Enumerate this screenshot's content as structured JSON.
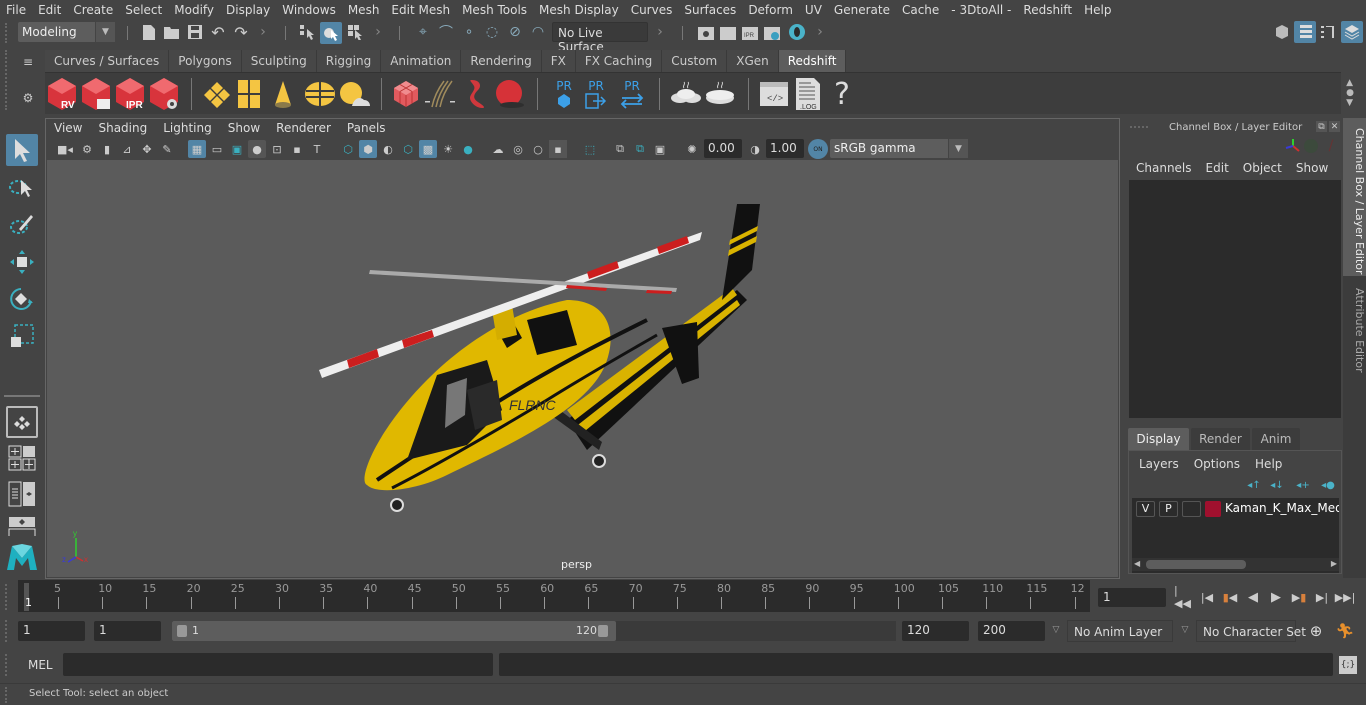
{
  "menubar": [
    "File",
    "Edit",
    "Create",
    "Select",
    "Modify",
    "Display",
    "Windows",
    "Mesh",
    "Edit Mesh",
    "Mesh Tools",
    "Mesh Display",
    "Curves",
    "Surfaces",
    "Deform",
    "UV",
    "Generate",
    "Cache",
    "- 3DtoAll -",
    "Redshift",
    "Help"
  ],
  "status_line": {
    "mode_dropdown": "Modeling",
    "live_surface": "No Live Surface"
  },
  "shelf": {
    "tabs": [
      "Curves / Surfaces",
      "Polygons",
      "Sculpting",
      "Rigging",
      "Animation",
      "Rendering",
      "FX",
      "FX Caching",
      "Custom",
      "XGen",
      "Redshift"
    ],
    "active_tab": "Redshift",
    "icons": [
      "redshift-rv-icon",
      "redshift-render-sequence-icon",
      "redshift-ipr-icon",
      "redshift-settings-icon",
      "rs-plane-light-icon",
      "rs-portal-light-icon",
      "rs-spot-light-icon",
      "rs-dome-light-icon",
      "rs-sun-sky-icon",
      "rs-volume-icon",
      "rs-hair-icon",
      "rs-proxy-export-icon",
      "rs-sphere-icon",
      "pr-create-icon",
      "pr-export-icon",
      "pr-swap-icon",
      "bake-one-icon",
      "bake-two-icon",
      "shader-code-icon",
      "log-icon",
      "help-icon"
    ],
    "labels": {
      "rv": "RV",
      "ipr": "IPR",
      "pr": "PR",
      "log": ".LOG",
      "help": "?"
    }
  },
  "viewport": {
    "menu": [
      "View",
      "Shading",
      "Lighting",
      "Show",
      "Renderer",
      "Panels"
    ],
    "exposure": "0.00",
    "gamma": "1.00",
    "color_mgmt_toggle": "ON",
    "color_space": "sRGB gamma",
    "camera_label": "persp",
    "model_text": "FLRNC",
    "axis": {
      "x": "x",
      "y": "y",
      "z": "z"
    }
  },
  "channel_box": {
    "title": "Channel Box / Layer Editor",
    "menu": [
      "Channels",
      "Edit",
      "Object",
      "Show"
    ],
    "layer_tabs": [
      "Display",
      "Render",
      "Anim"
    ],
    "active_layer_tab": "Display",
    "layer_menu": [
      "Layers",
      "Options",
      "Help"
    ],
    "layers": [
      {
        "v": "V",
        "p": "P",
        "color": "#a0102e",
        "name": "Kaman_K_Max_Medium"
      }
    ]
  },
  "side_tabs": [
    "Channel Box / Layer Editor",
    "Attribute Editor"
  ],
  "timeline": {
    "ticks": [
      "5",
      "10",
      "15",
      "20",
      "25",
      "30",
      "35",
      "40",
      "45",
      "50",
      "55",
      "60",
      "65",
      "70",
      "75",
      "80",
      "85",
      "90",
      "95",
      "100",
      "105",
      "110",
      "115",
      "12"
    ],
    "current_frame_marker": "1",
    "current_frame_field": "1"
  },
  "range": {
    "start_field": "1",
    "playback_start": "1",
    "slider_start": "1",
    "slider_end": "120",
    "playback_end": "120",
    "end_field": "200",
    "anim_layer": "No Anim Layer",
    "character_set": "No Character Set"
  },
  "command_line": {
    "label": "MEL",
    "value": ""
  },
  "help_line": "Select Tool: select an object"
}
